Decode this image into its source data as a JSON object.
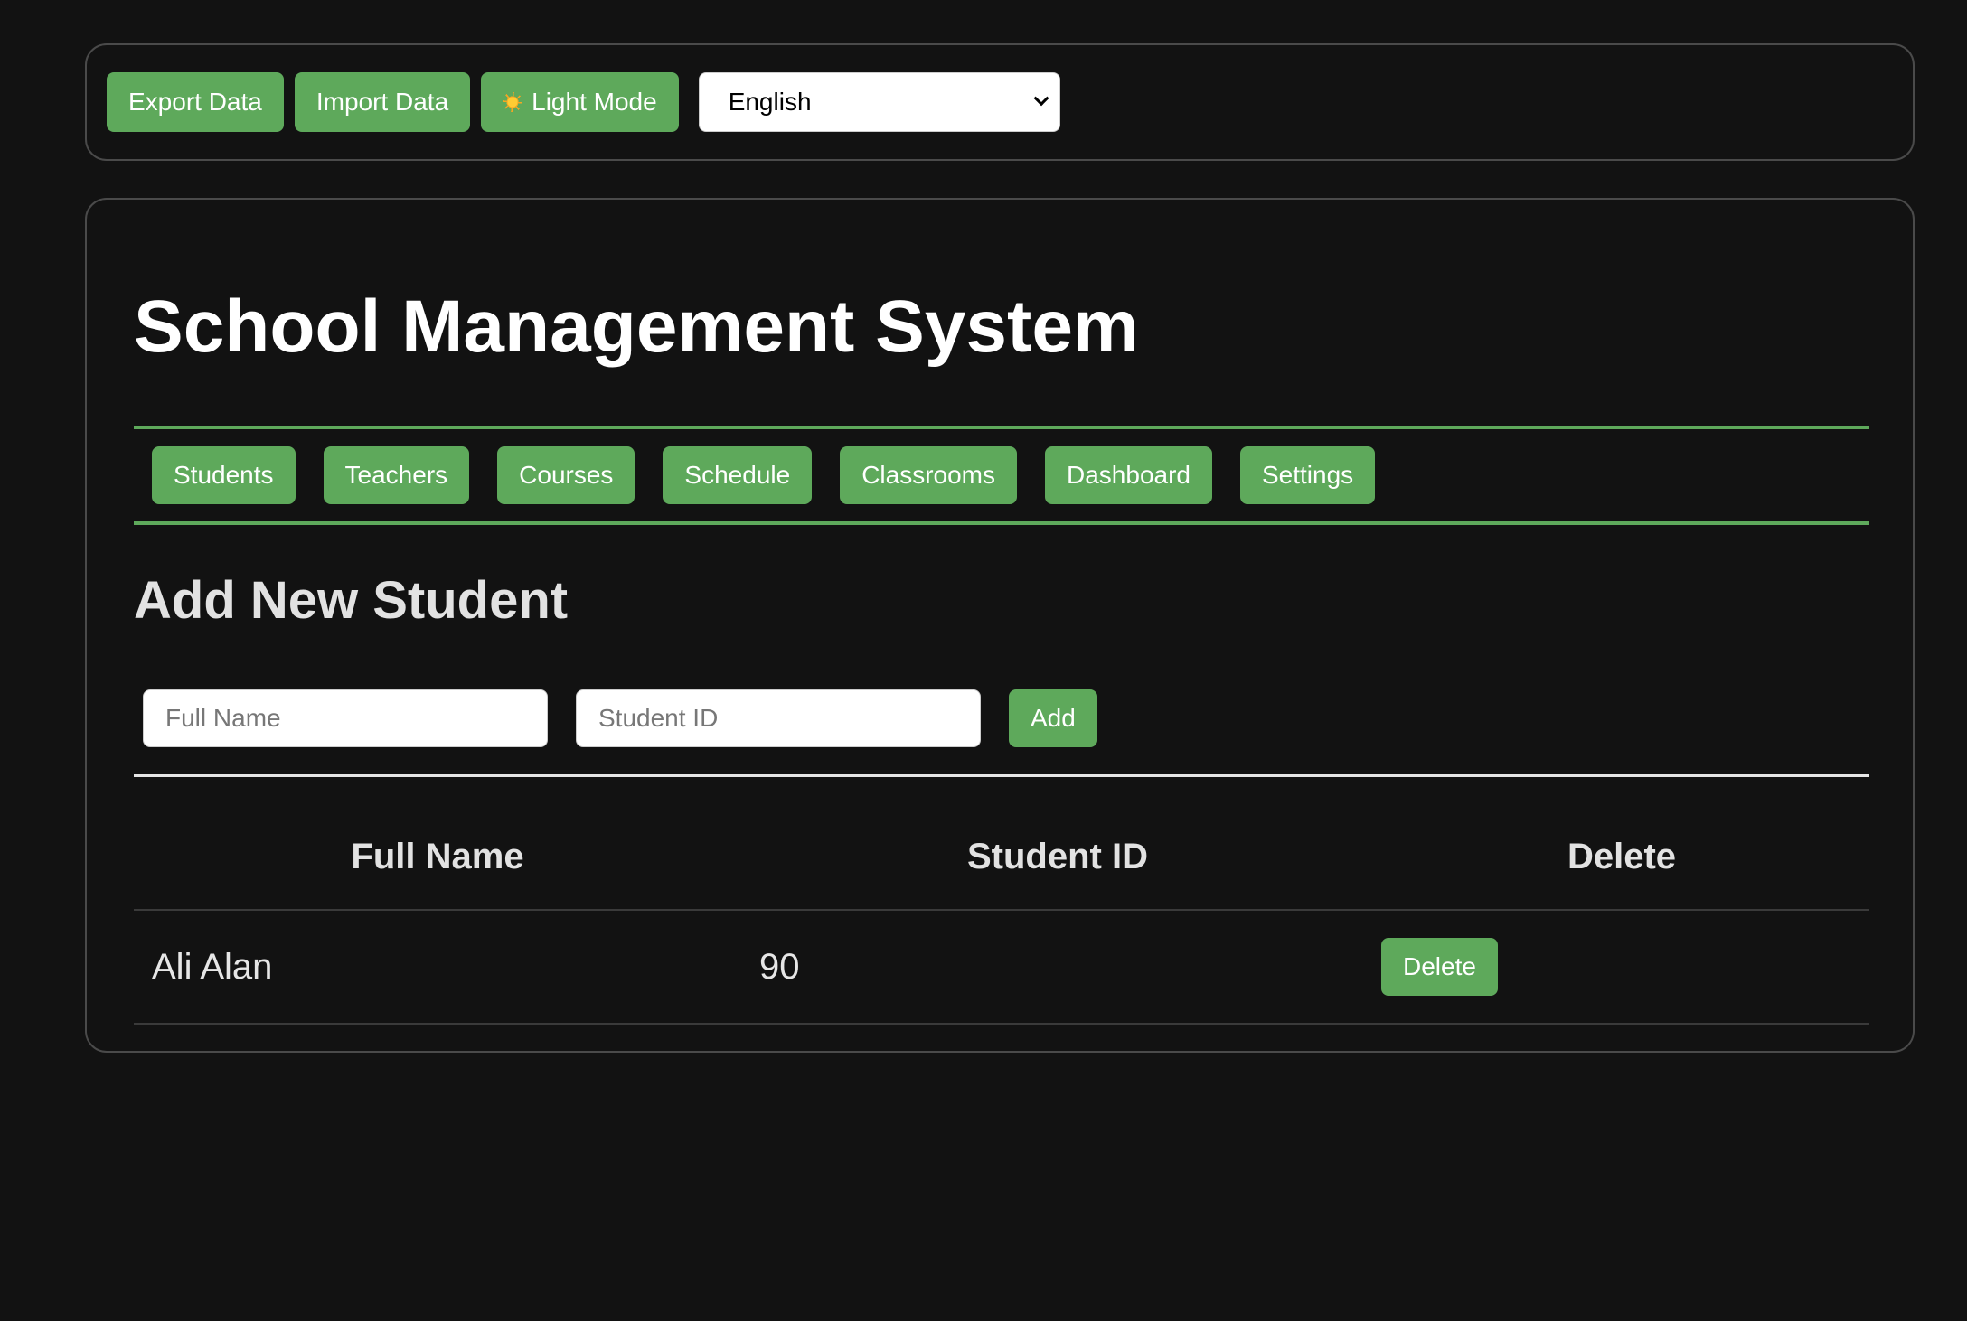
{
  "toolbar": {
    "export_label": "Export Data",
    "import_label": "Import Data",
    "theme_label": "Light Mode",
    "theme_icon": "sun-icon",
    "language": {
      "selected": "English",
      "options": [
        "English"
      ]
    }
  },
  "header": {
    "title": "School Management System"
  },
  "nav": {
    "items": [
      {
        "label": "Students"
      },
      {
        "label": "Teachers"
      },
      {
        "label": "Courses"
      },
      {
        "label": "Schedule"
      },
      {
        "label": "Classrooms"
      },
      {
        "label": "Dashboard"
      },
      {
        "label": "Settings"
      }
    ]
  },
  "form": {
    "title": "Add New Student",
    "name_placeholder": "Full Name",
    "name_value": "",
    "id_placeholder": "Student ID",
    "id_value": "",
    "add_label": "Add"
  },
  "table": {
    "columns": [
      "Full Name",
      "Student ID",
      "Delete"
    ],
    "rows": [
      {
        "name": "Ali Alan",
        "id": "90",
        "delete_label": "Delete"
      }
    ]
  },
  "colors": {
    "accent": "#5ea95b",
    "background": "#121212"
  }
}
